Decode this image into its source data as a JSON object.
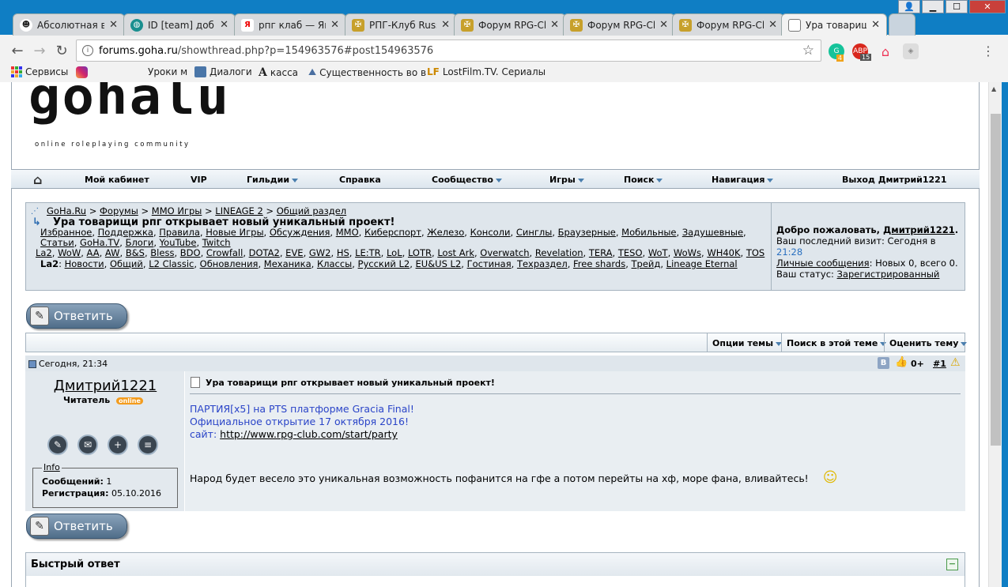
{
  "browser": {
    "tabs": [
      {
        "title": "Абсолютная в",
        "icon": "face-icon",
        "active": false
      },
      {
        "title": "ID [team] доб",
        "icon": "globe-icon",
        "active": false
      },
      {
        "title": "рпг клаб — Ян",
        "icon": "yandex-icon",
        "active": false
      },
      {
        "title": "РПГ-Клуб Russ",
        "icon": "rpg-club-icon",
        "active": false
      },
      {
        "title": "Форум RPG-Cl",
        "icon": "rpg-club-icon",
        "active": false
      },
      {
        "title": "Форум RPG-Cl",
        "icon": "rpg-club-icon",
        "active": false
      },
      {
        "title": "Форум RPG-Cl",
        "icon": "rpg-club-icon",
        "active": false
      },
      {
        "title": "Ура товарищ",
        "icon": "page-icon",
        "active": true
      }
    ],
    "url_host": "forums.goha.ru",
    "url_path": "/showthread.php?p=154963576#post154963576",
    "bookmarks": [
      {
        "label": "Сервисы",
        "icon": "apps-grid-icon"
      },
      {
        "label": "",
        "icon": "instagram-icon"
      },
      {
        "label": "Уроки м",
        "icon": "blank-icon"
      },
      {
        "label": "Диалоги",
        "icon": "chat-icon"
      },
      {
        "label": "касса",
        "icon": "letter-a-icon"
      },
      {
        "label": "Существенность во в",
        "icon": "mountain-icon"
      },
      {
        "label": "LostFilm.TV. Сериалы",
        "icon": "lf-icon"
      }
    ],
    "extension_badges": {
      "grammarly": "4",
      "adblock": "15"
    }
  },
  "site": {
    "logo_text": "gohalu",
    "logo_sub": "online roleplaying community",
    "nav": {
      "home": "",
      "cabinet": "Мой кабинет",
      "vip": "VIP",
      "guilds": "Гильдии",
      "help": "Справка",
      "community": "Сообщество",
      "games": "Игры",
      "search": "Поиск",
      "navigation": "Навигация",
      "logout": "Выход Дмитрий1221"
    }
  },
  "breadcrumb": {
    "items": [
      "GoHa.Ru",
      "Форумы",
      "MMO Игры",
      "LINEAGE 2",
      "Общий раздел"
    ],
    "sep": ">",
    "thread_title": "Ура товарищи рпг открывает новый уникальный проект!",
    "links_row1": [
      "Избранное",
      "Поддержка",
      "Правила",
      "Новые Игры",
      "Обсуждения",
      "MMO",
      "Киберспорт",
      "Железо",
      "Консоли",
      "Синглы",
      "Браузерные",
      "Мобильные",
      "Задушевные",
      "Статьи",
      "GoHa.TV",
      "Блоги",
      "YouTube",
      "Twitch"
    ],
    "links_row2": [
      "La2",
      "WoW",
      "AA",
      "AW",
      "B&S",
      "Bless",
      "BDO",
      "Crowfall",
      "DOTA2",
      "EVE",
      "GW2",
      "HS",
      "LE:TR",
      "LoL",
      "LOTR",
      "Lost Ark",
      "Overwatch",
      "Revelation",
      "TERA",
      "TESO",
      "WoT",
      "WoWs",
      "WH40K",
      "TOS"
    ],
    "la2_label": "La2",
    "links_row3": [
      "Новости",
      "Общий",
      "L2 Classic",
      "Обновления",
      "Механика",
      "Классы",
      "Русский L2",
      "EU&US L2",
      "Гостиная",
      "Техраздел",
      "Free shards",
      "Трейд",
      "Lineage Eternal"
    ]
  },
  "welcome": {
    "greeting": "Добро пожаловать,",
    "username": "Дмитрий1221",
    "last_visit_label": "Ваш последний визит: Сегодня в",
    "last_visit_time": "21:28",
    "pm_link": "Личные сообщения",
    "pm_text": ": Новых 0, всего 0.",
    "status_label": "Ваш статус:",
    "status_value": "Зарегистрированный"
  },
  "reply_button": "Ответить",
  "thread_tools": {
    "options": "Опции темы",
    "search": "Поиск в этой теме",
    "rate": "Оценить тему"
  },
  "post": {
    "date": "Сегодня, 21:34",
    "badge": "B",
    "rating": "0+",
    "number": "#1",
    "author": "Дмитрий1221",
    "rank": "Читатель",
    "online_badge": "online",
    "info_title": "Info",
    "messages_label": "Сообщений:",
    "messages_value": "1",
    "reg_label": "Регистрация:",
    "reg_value": "05.10.2016",
    "title": "Ура товарищи рпг открывает новый уникальный проект!",
    "line1": "ПАРТИЯ[x5] на PTS платформе Gracia Final!",
    "line2": "Официальное открытие 17 октября 2016!",
    "site_label": "сайт:",
    "site_link": "http://www.rpg-club.com/start/party",
    "body": "Народ будет весело это уникальная возможность пофанится на гфе а потом перейты на хф, море фана, вливайтесь!"
  },
  "quick_reply": {
    "title": "Быстрый ответ"
  },
  "colors": {
    "tabstrip": "#0f7ec4",
    "panel": "#dfe6ec",
    "link_blue": "#2a44c8"
  }
}
